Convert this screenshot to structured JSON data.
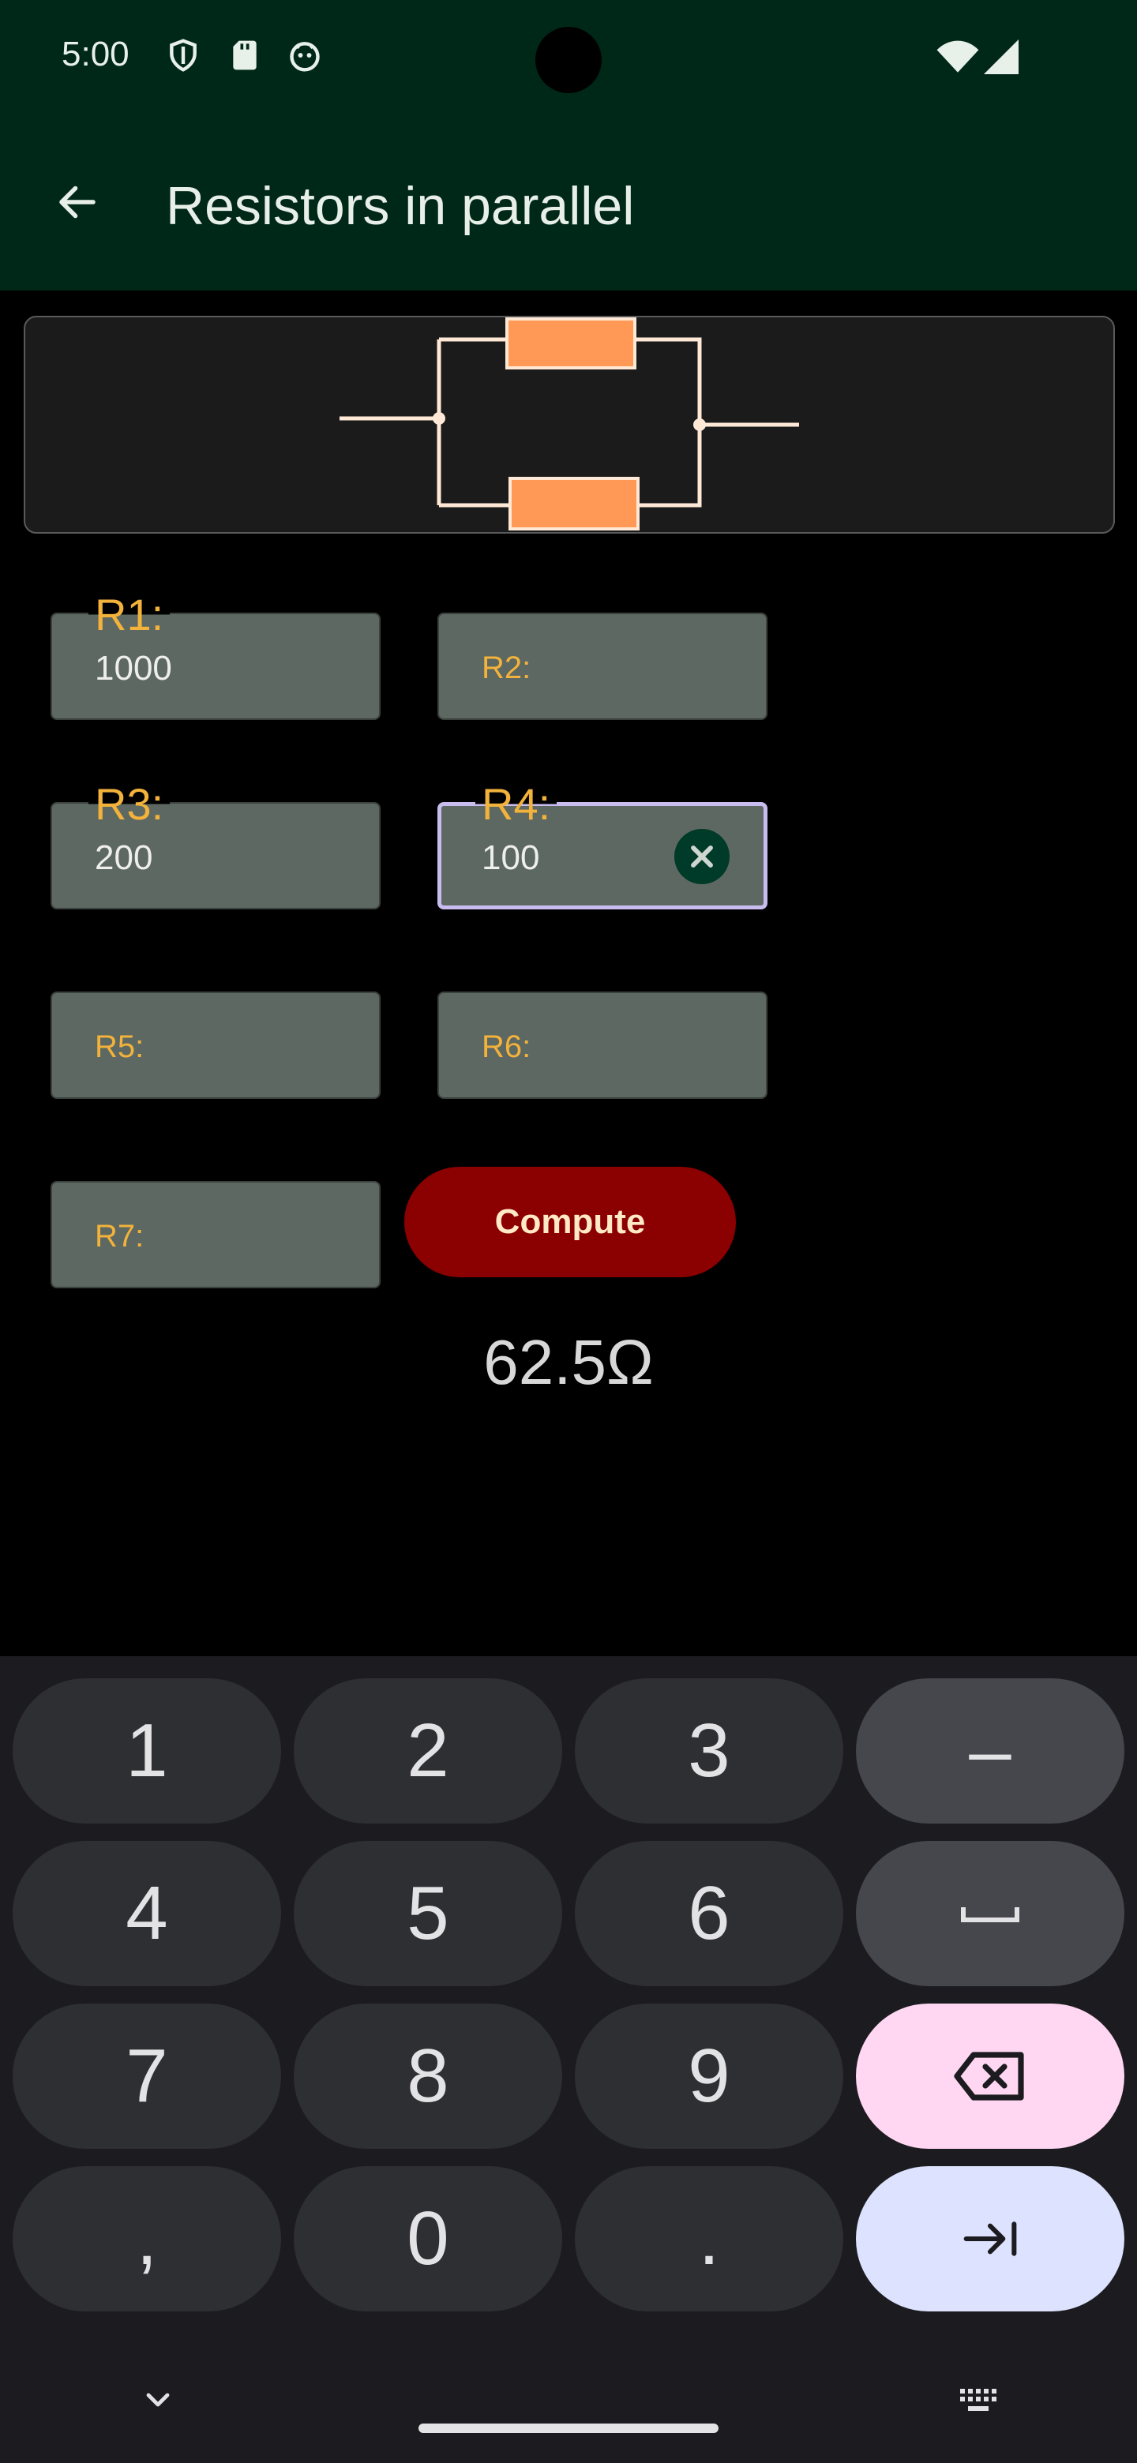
{
  "status": {
    "time": "5:00"
  },
  "appbar": {
    "title": "Resistors in parallel"
  },
  "fields": {
    "r1": {
      "label": "R1:",
      "value": "1000"
    },
    "r2": {
      "label": "R2:"
    },
    "r3": {
      "label": "R3:",
      "value": "200"
    },
    "r4": {
      "label": "R4:",
      "value": "100"
    },
    "r5": {
      "label": "R5:"
    },
    "r6": {
      "label": "R6:"
    },
    "r7": {
      "label": "R7:"
    }
  },
  "compute_label": "Compute",
  "result": "62.5Ω",
  "keyboard": {
    "k1": "1",
    "k2": "2",
    "k3": "3",
    "kminus": "–",
    "k4": "4",
    "k5": "5",
    "k6": "6",
    "k7": "7",
    "k8": "8",
    "k9": "9",
    "kcomma": ",",
    "k0": "0",
    "kdot": "."
  },
  "colors": {
    "accent": "#8b0000",
    "label": "#f2b23b",
    "appbar": "#002818",
    "field": "#5c6861",
    "resistor": "#ff9955"
  }
}
